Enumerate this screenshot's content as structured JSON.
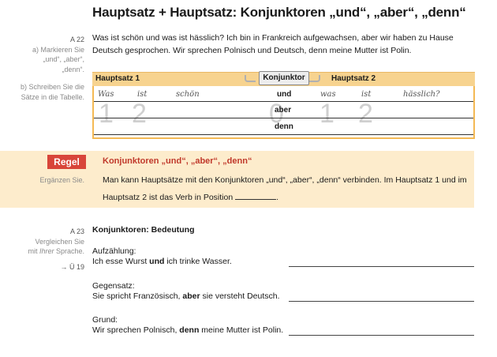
{
  "title": "Hauptsatz + Hauptsatz: Konjunktoren „und“, „aber“, „denn“",
  "a22": {
    "num": "A 22",
    "instr_a": [
      "a) Markieren Sie",
      "„und“, „aber“,",
      "„denn“."
    ],
    "instr_b": [
      "b) Schreiben Sie die",
      "Sätze in die Tabelle."
    ],
    "text": "Was ist schön und was ist hässlich? Ich bin in Frankreich aufgewachsen, aber wir haben zu Hause Deutsch gesprochen. Wir sprechen Polnisch und Deutsch, denn meine Mutter ist Polin."
  },
  "table": {
    "head_left": "Hauptsatz 1",
    "head_mid": "Konjunktor",
    "head_right": "Hauptsatz 2",
    "example_left": [
      "Was",
      "ist",
      "schön"
    ],
    "example_right": [
      "was",
      "ist",
      "hässlich?"
    ],
    "konjunktoren": [
      "und",
      "aber",
      "denn"
    ],
    "pos_left": [
      "1",
      "2"
    ],
    "pos_mid": "0",
    "pos_right": [
      "1",
      "2"
    ]
  },
  "regel": {
    "tag": "Regel",
    "side": "Ergänzen Sie.",
    "title": "Konjunktoren „und“, „aber“, „denn“",
    "line1": "Man kann Hauptsätze mit den Konjunktoren „und“, „aber“, „denn“ verbinden. Im Hauptsatz 1 und im",
    "line2": "Hauptsatz 2 ist das Verb in Position",
    "line2_end": "."
  },
  "a23": {
    "num": "A 23",
    "instr": [
      "Vergleichen Sie",
      "mit ",
      "Ihrer",
      " Sprache."
    ],
    "ref": "→ Ü 19",
    "title": "Konjunktoren: Bedeutung",
    "groups": [
      {
        "label": "Aufzählung:",
        "pre": "Ich esse Wurst ",
        "bold": "und",
        "post": " ich trinke Wasser."
      },
      {
        "label": "Gegensatz:",
        "pre": "Sie spricht Französisch, ",
        "bold": "aber",
        "post": " sie versteht Deutsch."
      },
      {
        "label": "Grund:",
        "pre": "Wir sprechen Polnisch, ",
        "bold": "denn",
        "post": " meine Mutter ist Polin."
      }
    ]
  }
}
